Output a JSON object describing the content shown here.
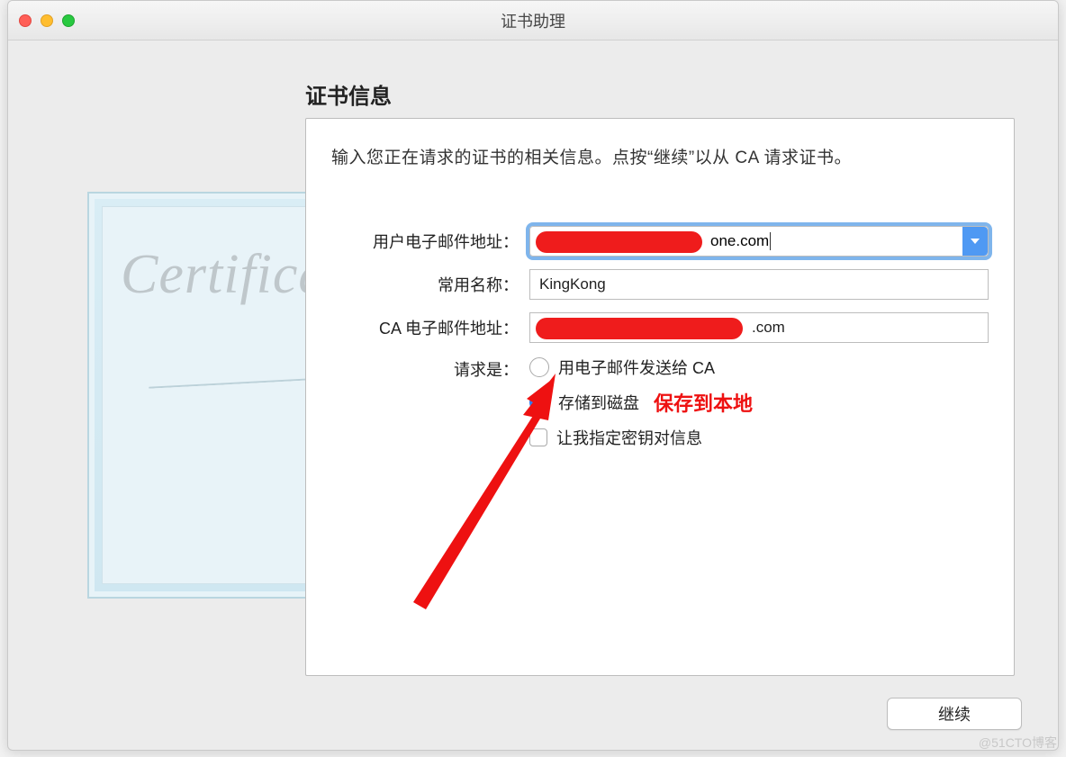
{
  "window": {
    "title": "证书助理"
  },
  "panel": {
    "heading": "证书信息",
    "instructions": "输入您正在请求的证书的相关信息。点按“继续”以从 CA 请求证书。"
  },
  "form": {
    "user_email_label": "用户电子邮件地址：",
    "user_email_value_suffix": "one.com",
    "common_name_label": "常用名称：",
    "common_name_value": "KingKong",
    "ca_email_label": "CA 电子邮件地址：",
    "ca_email_value_suffix": ".com",
    "request_is_label": "请求是：",
    "radio_email_ca": "用电子邮件发送给 CA",
    "radio_save_disk": "存储到磁盘",
    "checkbox_key_pair": "让我指定密钥对信息"
  },
  "annotation": {
    "save_local": "保存到本地"
  },
  "buttons": {
    "continue": "继续"
  },
  "watermark": "@51CTO博客",
  "decoration": {
    "certificate_script": "Certificate"
  }
}
